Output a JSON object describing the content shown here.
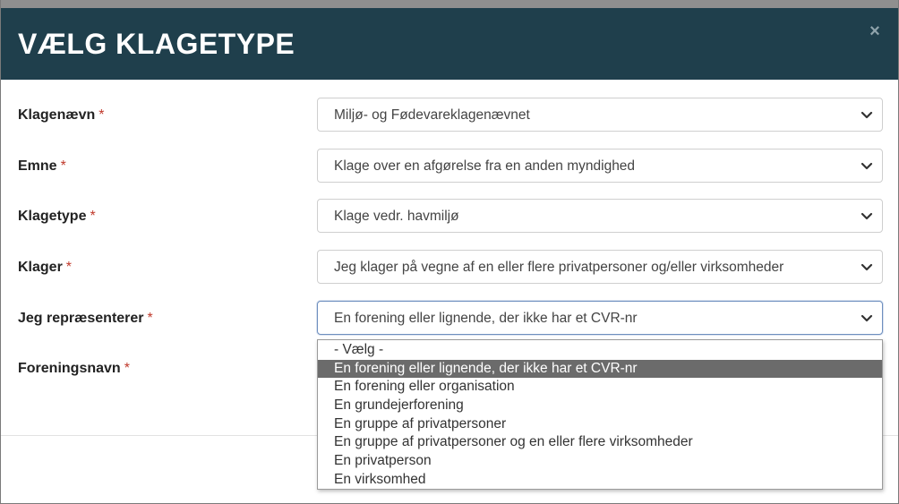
{
  "dialog": {
    "title": "VÆLG KLAGETYPE",
    "close_symbol": "×"
  },
  "form": {
    "required_marker": "*",
    "fields": [
      {
        "label": "Klagenævn",
        "value": "Miljø- og Fødevareklagenævnet"
      },
      {
        "label": "Emne",
        "value": "Klage over en afgørelse fra en anden myndighed"
      },
      {
        "label": "Klagetype",
        "value": "Klage vedr. havmiljø"
      },
      {
        "label": "Klager",
        "value": "Jeg klager på vegne af en eller flere privatpersoner og/eller virksomheder"
      },
      {
        "label": "Jeg repræsenterer",
        "value": "En forening eller lignende, der ikke har et CVR-nr"
      },
      {
        "label": "Foreningsnavn",
        "value": ""
      }
    ]
  },
  "dropdown": {
    "selected_index": 1,
    "options": [
      "- Vælg -",
      "En forening eller lignende, der ikke har et CVR-nr",
      "En forening eller organisation",
      "En grundejerforening",
      "En gruppe af privatpersoner",
      "En gruppe af privatpersoner og en eller flere virksomheder",
      "En privatperson",
      "En virksomhed"
    ]
  },
  "colors": {
    "header_bg": "#1f3f4c",
    "required": "#c0392b",
    "option_selected_bg": "#6b6b6b",
    "focus_border": "#6e8fbf"
  },
  "icons": {
    "close": "close-icon",
    "select_arrow": "chevron-down-icon"
  }
}
